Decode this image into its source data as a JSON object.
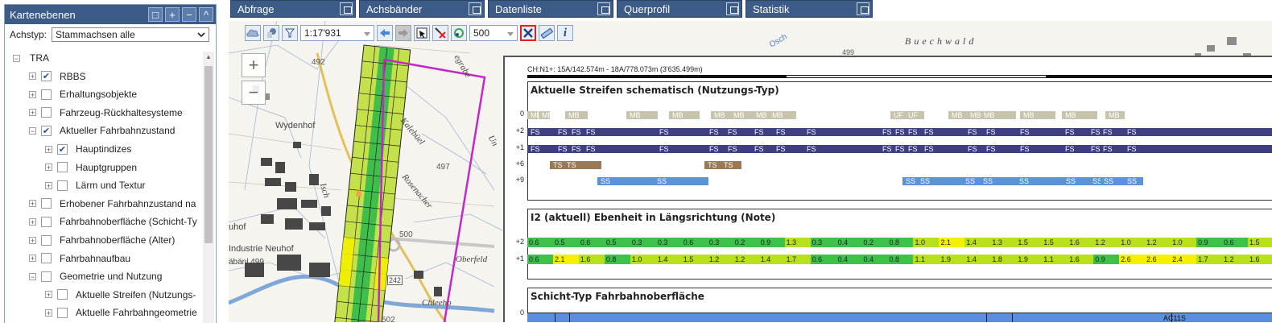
{
  "panel": {
    "title": "Kartenebenen",
    "buttons": [
      "□",
      "+",
      "−",
      "^"
    ],
    "achstyp_label": "Achstyp:",
    "achstyp_value": "Stammachsen alle"
  },
  "tree": [
    {
      "label": "TRA",
      "level": 0,
      "expander": "−",
      "checkbox": "none"
    },
    {
      "label": "RBBS",
      "level": 1,
      "expander": "+",
      "checkbox": "checked"
    },
    {
      "label": "Erhaltungsobjekte",
      "level": 1,
      "expander": "+",
      "checkbox": "empty"
    },
    {
      "label": "Fahrzeug-Rückhaltesysteme",
      "level": 1,
      "expander": "+",
      "checkbox": "empty"
    },
    {
      "label": "Aktueller Fahrbahnzustand",
      "level": 1,
      "expander": "−",
      "checkbox": "checked"
    },
    {
      "label": "Hauptindizes",
      "level": 2,
      "expander": "+",
      "checkbox": "checked"
    },
    {
      "label": "Hauptgruppen",
      "level": 2,
      "expander": "+",
      "checkbox": "empty"
    },
    {
      "label": "Lärm und Textur",
      "level": 2,
      "expander": "+",
      "checkbox": "empty"
    },
    {
      "label": "Erhobener Fahrbahnzustand na",
      "level": 1,
      "expander": "+",
      "checkbox": "empty"
    },
    {
      "label": "Fahrbahnoberfläche (Schicht-Ty",
      "level": 1,
      "expander": "+",
      "checkbox": "empty"
    },
    {
      "label": "Fahrbahnoberfläche (Alter)",
      "level": 1,
      "expander": "+",
      "checkbox": "empty"
    },
    {
      "label": "Fahrbahnaufbau",
      "level": 1,
      "expander": "+",
      "checkbox": "empty"
    },
    {
      "label": "Geometrie und Nutzung",
      "level": 1,
      "expander": "−",
      "checkbox": "empty"
    },
    {
      "label": "Aktuelle Streifen (Nutzungs-",
      "level": 2,
      "expander": "+",
      "checkbox": "empty"
    },
    {
      "label": "Aktuelle Fahrbahngeometrie",
      "level": 2,
      "expander": "+",
      "checkbox": "empty"
    }
  ],
  "tabs": [
    "Abfrage",
    "Achsbänder",
    "Datenliste",
    "Querprofil",
    "Statistik"
  ],
  "toolbar": {
    "scale": "1:17'931",
    "distance": "500",
    "icons": [
      "cloud-icon",
      "hand-info-icon",
      "filter-icon",
      "back-arrow-icon",
      "forward-arrow-icon",
      "select-arrow-icon",
      "remove-selection-icon",
      "refresh-icon",
      "close-profile-icon",
      "measure-icon",
      "info-icon"
    ]
  },
  "map": {
    "zoom_in": "+",
    "zoom_out": "−",
    "labels": [
      "492",
      "Wydenhof",
      "Kalebüel",
      "Rosenacher",
      "497",
      "500",
      "Oberfeld",
      "Industrie Neuhof",
      "äbänl 499",
      "Chleeho",
      "242",
      "502",
      "uhof",
      "Buechwald",
      "Osch",
      "499",
      "Isch",
      "egrabe",
      "Un"
    ]
  },
  "profile": {
    "header": "CH:N1+: 15A/142.574m - 18A/778.073m (3'635.499m)",
    "sections": [
      {
        "title": "Aktuelle Streifen schematisch (Nutzungs-Typ)",
        "lanes": [
          {
            "label": "0",
            "color": "#c8c3ad",
            "segs": [
              [
                0,
                9,
                "MB"
              ],
              [
                14,
                10,
                "MB"
              ],
              [
                47,
                24,
                "MB"
              ],
              [
                123,
                35,
                "MB"
              ],
              [
                176,
                34,
                "MB"
              ],
              [
                228,
                40,
                "MB"
              ],
              [
                228,
                0,
                ""
              ],
              [
                252,
                24,
                "MB"
              ],
              [
                280,
                30,
                "MB"
              ],
              [
                300,
                30,
                "MB"
              ],
              [
                451,
                20,
                "UF"
              ],
              [
                469,
                20,
                "UF"
              ],
              [
                523,
                29,
                "MB"
              ],
              [
                546,
                29,
                "MB"
              ],
              [
                563,
                40,
                "MB"
              ],
              [
                612,
                40,
                "MB"
              ],
              [
                664,
                40,
                "MB"
              ],
              [
                718,
                20,
                "MB"
              ]
            ]
          },
          {
            "label": "+2",
            "color": "#3e3f80",
            "segs": [
              [
                0,
                14,
                "FS"
              ],
              [
                34,
                14,
                "FS"
              ],
              [
                51,
                14,
                "FS"
              ],
              [
                69,
                14,
                "FS"
              ],
              [
                160,
                14,
                "FS"
              ],
              [
                222,
                14,
                "FS"
              ],
              [
                245,
                14,
                "FS"
              ],
              [
                278,
                14,
                "FS"
              ],
              [
                305,
                14,
                "FS"
              ],
              [
                343,
                14,
                "FS"
              ],
              [
                437,
                14,
                "FS"
              ],
              [
                453,
                14,
                "FS"
              ],
              [
                469,
                14,
                "FS"
              ],
              [
                489,
                14,
                "FS"
              ],
              [
                543,
                14,
                "FS"
              ],
              [
                566,
                14,
                "FS"
              ],
              [
                608,
                14,
                "FS"
              ],
              [
                664,
                14,
                "FS"
              ],
              [
                696,
                14,
                "FS"
              ],
              [
                711,
                14,
                "FS"
              ],
              [
                741,
                14,
                "FS"
              ]
            ]
          },
          {
            "label": "+1",
            "color": "#3e3f80",
            "segs": [
              [
                0,
                14,
                "FS"
              ],
              [
                34,
                14,
                "FS"
              ],
              [
                51,
                14,
                "FS"
              ],
              [
                69,
                14,
                "FS"
              ],
              [
                160,
                14,
                "FS"
              ],
              [
                222,
                14,
                "FS"
              ],
              [
                245,
                14,
                "FS"
              ],
              [
                278,
                14,
                "FS"
              ],
              [
                305,
                14,
                "FS"
              ],
              [
                343,
                14,
                "FS"
              ],
              [
                437,
                14,
                "FS"
              ],
              [
                453,
                14,
                "FS"
              ],
              [
                469,
                14,
                "FS"
              ],
              [
                489,
                14,
                "FS"
              ],
              [
                543,
                14,
                "FS"
              ],
              [
                566,
                14,
                "FS"
              ],
              [
                608,
                14,
                "FS"
              ],
              [
                664,
                14,
                "FS"
              ],
              [
                696,
                14,
                "FS"
              ],
              [
                711,
                14,
                "FS"
              ],
              [
                741,
                14,
                "FS"
              ]
            ]
          },
          {
            "label": "+6",
            "color": "#9a7a55",
            "segs": [
              [
                28,
                20,
                "TS"
              ],
              [
                45,
                43,
                "TS"
              ],
              [
                220,
                20,
                "TS"
              ],
              [
                240,
                22,
                "TS"
              ]
            ]
          },
          {
            "label": "+9",
            "color": "#5a93d8",
            "segs": [
              [
                87,
                70,
                "SS"
              ],
              [
                157,
                64,
                "SS"
              ],
              [
                466,
                18,
                "SS"
              ],
              [
                484,
                56,
                "SS"
              ],
              [
                540,
                22,
                "SS"
              ],
              [
                562,
                45,
                "SS"
              ],
              [
                607,
                58,
                "SS"
              ],
              [
                665,
                33,
                "SS"
              ],
              [
                698,
                14,
                "SS"
              ],
              [
                712,
                29,
                "SS"
              ],
              [
                741,
                20,
                "SS"
              ]
            ]
          }
        ]
      },
      {
        "title": "I2 (aktuell) Ebenheit in Längsrichtung (Note)",
        "lanes": [
          {
            "label": "+2",
            "values": [
              "0.6",
              "0.5",
              "0.6",
              "0.5",
              "0.3",
              "0.3",
              "0.6",
              "0.3",
              "0.2",
              "0.9",
              "1.3",
              "0.3",
              "0.4",
              "0.2",
              "0.8",
              "1.0",
              "2.1",
              "1.4",
              "1.3",
              "1.5",
              "1.5",
              "1.6",
              "1.2",
              "1.0",
              "1.2",
              "1.0",
              "0.9",
              "0.6",
              "1.5"
            ]
          },
          {
            "label": "+1",
            "values": [
              "0.6",
              "2.1",
              "1.6",
              "0.8",
              "1.0",
              "1.4",
              "1.5",
              "1.2",
              "1.2",
              "1.4",
              "1.7",
              "0.6",
              "0.4",
              "0.4",
              "0.8",
              "1.1",
              "1.9",
              "1.4",
              "1.8",
              "1.9",
              "1.1",
              "1.6",
              "0.9",
              "2.6",
              "2.6",
              "2.4",
              "1.7",
              "1.2",
              "1.6"
            ]
          }
        ]
      },
      {
        "title": "Schicht-Typ Fahrbahnoberfläche",
        "lanes": [
          {
            "label": "0"
          }
        ],
        "bottom_text": "AC11S"
      }
    ],
    "colors": {
      "green": "#3cc14a",
      "lime": "#b8e01c",
      "yellow": "#f4f000",
      "blue": "#5b8ee0"
    }
  }
}
